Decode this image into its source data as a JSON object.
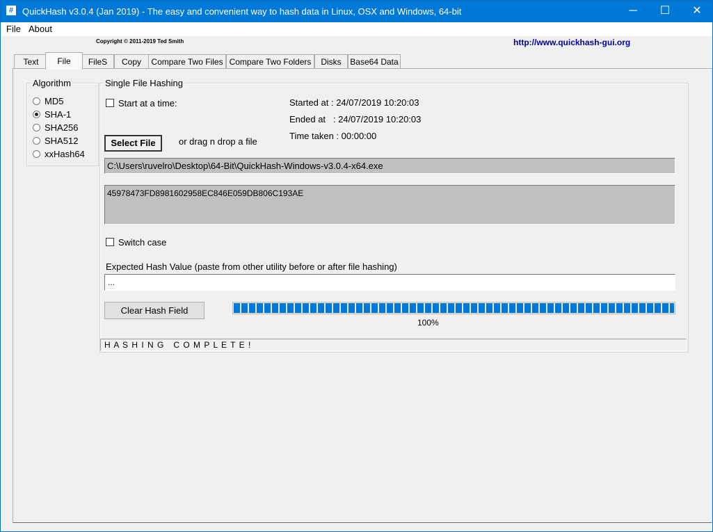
{
  "window": {
    "title": "QuickHash v3.0.4 (Jan 2019) - The easy and convenient way to hash data in Linux, OSX and Windows, 64-bit",
    "icon": "#",
    "minimize_glyph": "─",
    "maximize_glyph": "☐",
    "close_glyph": "✕"
  },
  "menu": {
    "items": [
      {
        "label": "File"
      },
      {
        "label": "About"
      }
    ]
  },
  "header": {
    "copyright": "Copyright © 2011-2019  Ted Smith",
    "website": "http://www.quickhash-gui.org"
  },
  "tabs": [
    {
      "label": "Text"
    },
    {
      "label": "File",
      "active": true
    },
    {
      "label": "FileS"
    },
    {
      "label": "Copy"
    },
    {
      "label": "Compare Two Files"
    },
    {
      "label": "Compare Two Folders"
    },
    {
      "label": "Disks"
    },
    {
      "label": "Base64 Data"
    }
  ],
  "algorithm": {
    "caption": "Algorithm",
    "options": [
      {
        "label": "MD5",
        "selected": false
      },
      {
        "label": "SHA-1",
        "selected": true
      },
      {
        "label": "SHA256",
        "selected": false
      },
      {
        "label": "SHA512",
        "selected": false
      },
      {
        "label": "xxHash64",
        "selected": false
      }
    ]
  },
  "single_file": {
    "caption": "Single File Hashing",
    "start_at_label": "Start at a time:",
    "start_at_checked": false,
    "started_at": "Started at : 24/07/2019 10:20:03",
    "ended_at": "Ended at   : 24/07/2019 10:20:03",
    "time_taken": "Time taken : 00:00:00",
    "select_file_label": "Select File",
    "drag_drop_label": "or drag n drop a file",
    "file_path": "C:\\Users\\ruvelro\\Desktop\\64-Bit\\QuickHash-Windows-v3.0.4-x64.exe",
    "hash_value": "45978473FD8981602958EC846E059DB806C193AE",
    "switch_case_label": "Switch case",
    "switch_case_checked": false,
    "expected_hash_label": "Expected Hash Value (paste from other utility before or after file hashing)",
    "expected_hash_value": "...",
    "clear_hash_label": "Clear Hash Field",
    "progress_percent": 100,
    "progress_text": "100%",
    "status": "H A S H I N G   C O M P L E T E !"
  }
}
